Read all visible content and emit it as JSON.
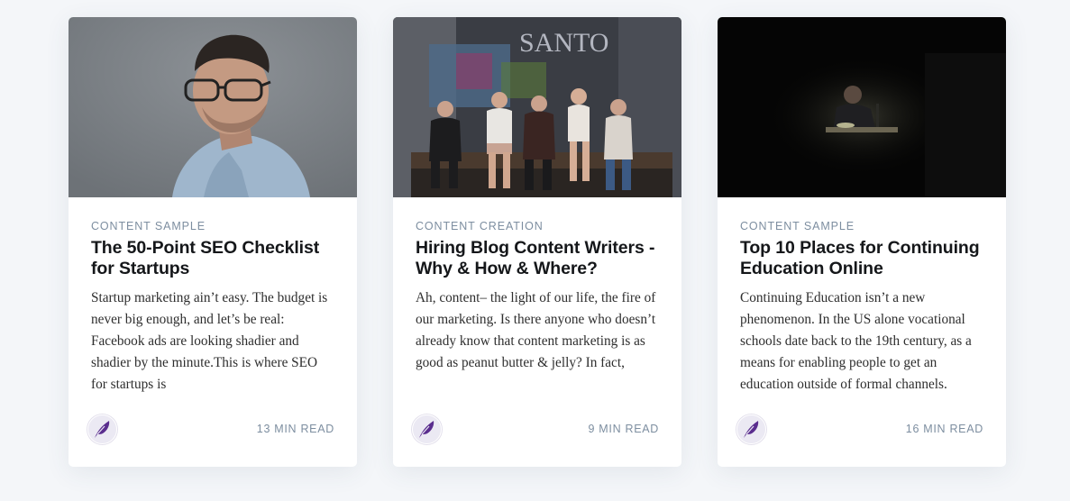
{
  "posts": [
    {
      "tag": "CONTENT SAMPLE",
      "title": "The 50-Point SEO Checklist for Startups",
      "excerpt": "Startup marketing ain’t easy. The budget is never big enough, and let’s be real: Facebook ads are looking shadier and shadier by the minute.This is where SEO for startups is",
      "reading_time": "13 MIN READ",
      "image": "portrait-man-glasses",
      "author_icon": "quill-feather-icon"
    },
    {
      "tag": "CONTENT CREATION",
      "title": "Hiring Blog Content Writers - Why & How & Where?",
      "excerpt": "Ah, content– the light of our life, the fire of our marketing. Is there anyone who doesn’t already know that content marketing is as good as peanut butter & jelly? In fact,",
      "reading_time": "9 MIN READ",
      "image": "group-of-five-people-sitting",
      "author_icon": "quill-feather-icon"
    },
    {
      "tag": "CONTENT SAMPLE",
      "title": "Top 10 Places for Continuing Education Online",
      "excerpt": "Continuing Education isn’t a new phenomenon. In the US alone vocational schools date back to the 19th century, as a means for enabling people to get an education outside of formal channels.",
      "reading_time": "16 MIN READ",
      "image": "person-studying-dark-room",
      "author_icon": "quill-feather-icon"
    }
  ],
  "colors": {
    "page_background": "#f4f6f9",
    "card_background": "#ffffff",
    "tag_text": "#7d8ea0",
    "title_text": "#15171a",
    "excerpt_text": "#2e2e2e",
    "author_icon": "#5a2d8e"
  }
}
